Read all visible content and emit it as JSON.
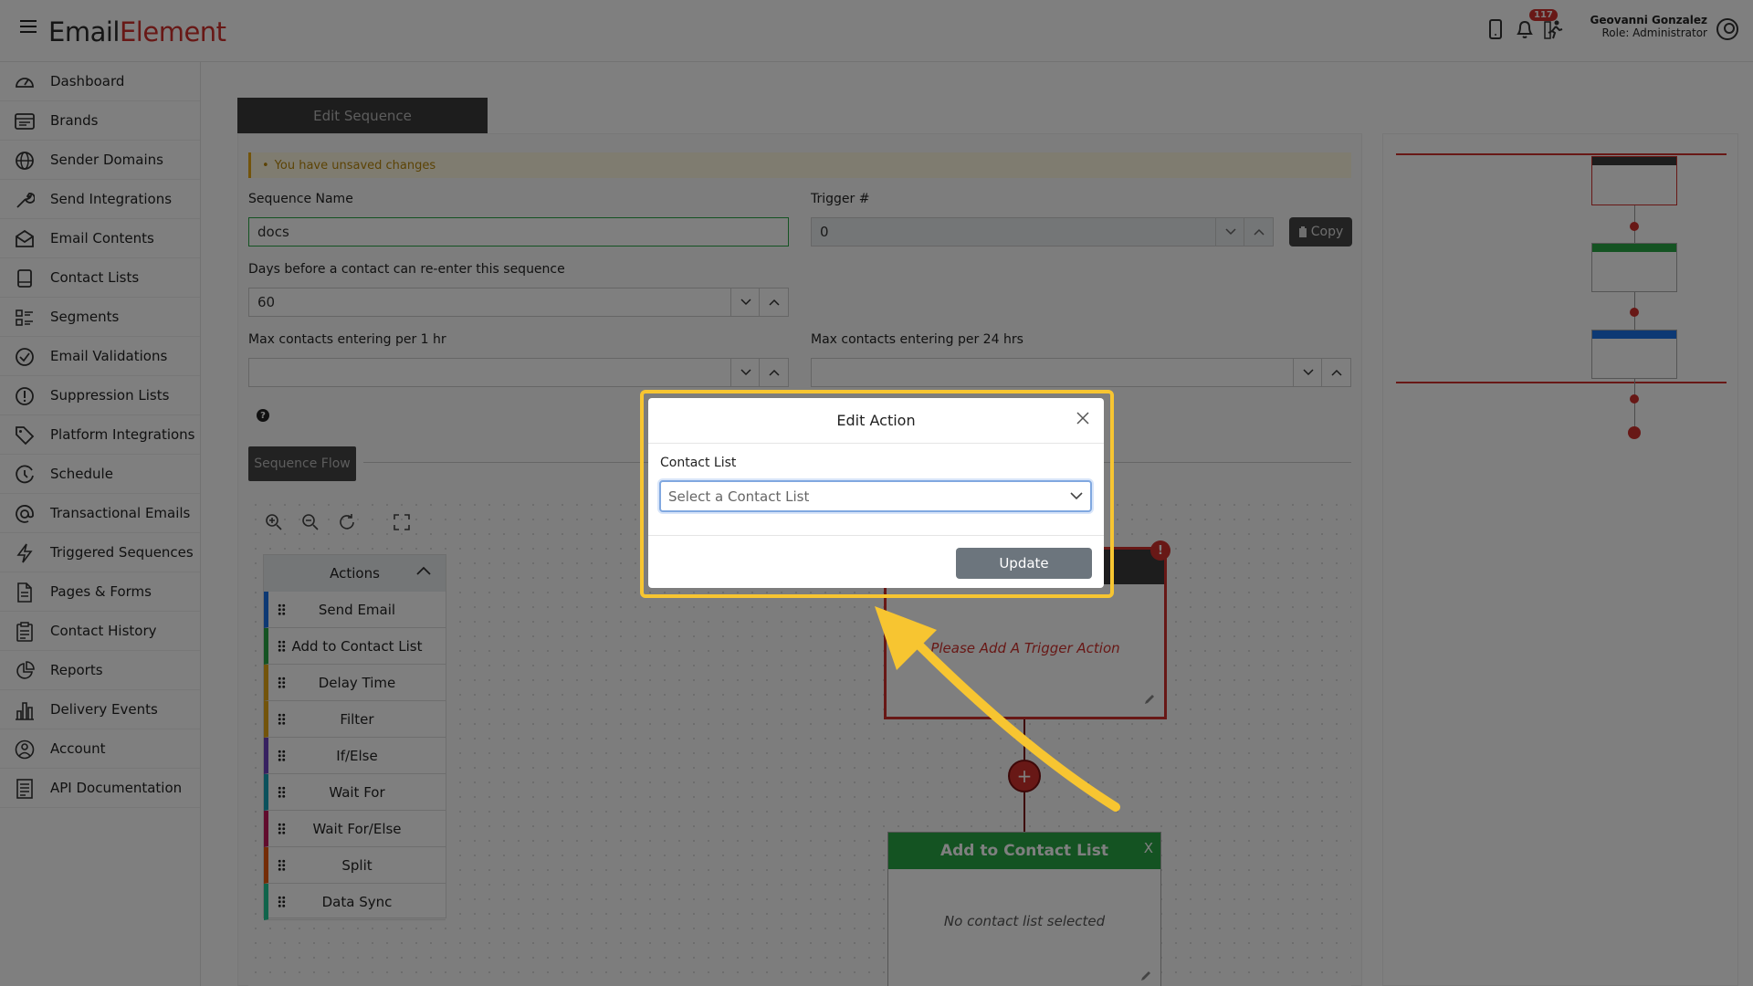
{
  "header": {
    "logo_part1": "E",
    "logo_mid": "m",
    "logo_part2": "ail",
    "logo_part3": "Element",
    "notification_count": "117",
    "user_name": "Geovanni Gonzalez",
    "user_role": "Role: Administrator"
  },
  "sidebar": {
    "items": [
      {
        "label": "Dashboard",
        "icon": "dashboard-icon"
      },
      {
        "label": "Brands",
        "icon": "brands-icon"
      },
      {
        "label": "Sender Domains",
        "icon": "globe-icon"
      },
      {
        "label": "Send Integrations",
        "icon": "wrench-icon"
      },
      {
        "label": "Email Contents",
        "icon": "envelope-icon"
      },
      {
        "label": "Contact Lists",
        "icon": "book-icon"
      },
      {
        "label": "Segments",
        "icon": "segments-icon"
      },
      {
        "label": "Email Validations",
        "icon": "check-circle-icon"
      },
      {
        "label": "Suppression Lists",
        "icon": "exclamation-circle-icon"
      },
      {
        "label": "Platform Integrations",
        "icon": "tag-icon"
      },
      {
        "label": "Schedule",
        "icon": "clock-icon"
      },
      {
        "label": "Transactional Emails",
        "icon": "at-icon"
      },
      {
        "label": "Triggered Sequences",
        "icon": "lightning-icon"
      },
      {
        "label": "Pages & Forms",
        "icon": "file-icon"
      },
      {
        "label": "Contact History",
        "icon": "clipboard-icon"
      },
      {
        "label": "Reports",
        "icon": "pie-chart-icon"
      },
      {
        "label": "Delivery Events",
        "icon": "bar-chart-icon"
      },
      {
        "label": "Account",
        "icon": "user-circle-icon"
      },
      {
        "label": "API Documentation",
        "icon": "api-doc-icon"
      }
    ]
  },
  "main": {
    "tab_label": "Edit Sequence",
    "unsaved_notice": "You have unsaved changes",
    "sequence_name_label": "Sequence Name",
    "sequence_name_value": "docs",
    "trigger_label": "Trigger #",
    "trigger_value": "0",
    "copy_label": "Copy",
    "reenter_label": "Days before a contact can re-enter this sequence",
    "reenter_value": "60",
    "max_1hr_label": "Max contacts entering per 1 hr",
    "max_24hr_label": "Max contacts entering per 24 hrs",
    "help_glyph": "?",
    "sequence_flow_label": "Sequence Flow"
  },
  "actions_panel": {
    "title": "Actions",
    "items": [
      {
        "label": "Send Email",
        "color": "#1a73e8"
      },
      {
        "label": "Add to Contact List",
        "color": "#28a745"
      },
      {
        "label": "Delay Time",
        "color": "#e6a817"
      },
      {
        "label": "Filter",
        "color": "#e6a817"
      },
      {
        "label": "If/Else",
        "color": "#6f42c1"
      },
      {
        "label": "Wait For",
        "color": "#17a2b8"
      },
      {
        "label": "Wait For/Else",
        "color": "#c2185b"
      },
      {
        "label": "Split",
        "color": "#e8590c"
      },
      {
        "label": "Data Sync",
        "color": "#20c997"
      }
    ]
  },
  "flow": {
    "trigger_placeholder": "Please Add A Trigger Action",
    "warning_glyph": "!",
    "plus_glyph": "+",
    "contact_node_title": "Add to Contact List",
    "contact_node_close": "X",
    "contact_node_body": "No contact list selected"
  },
  "modal": {
    "title": "Edit Action",
    "field_label": "Contact List",
    "select_placeholder": "Select a Contact List",
    "update_label": "Update"
  },
  "colors": {
    "brand_red": "#d0312d",
    "highlight_yellow": "#f7c531",
    "node_green": "#28a745"
  }
}
